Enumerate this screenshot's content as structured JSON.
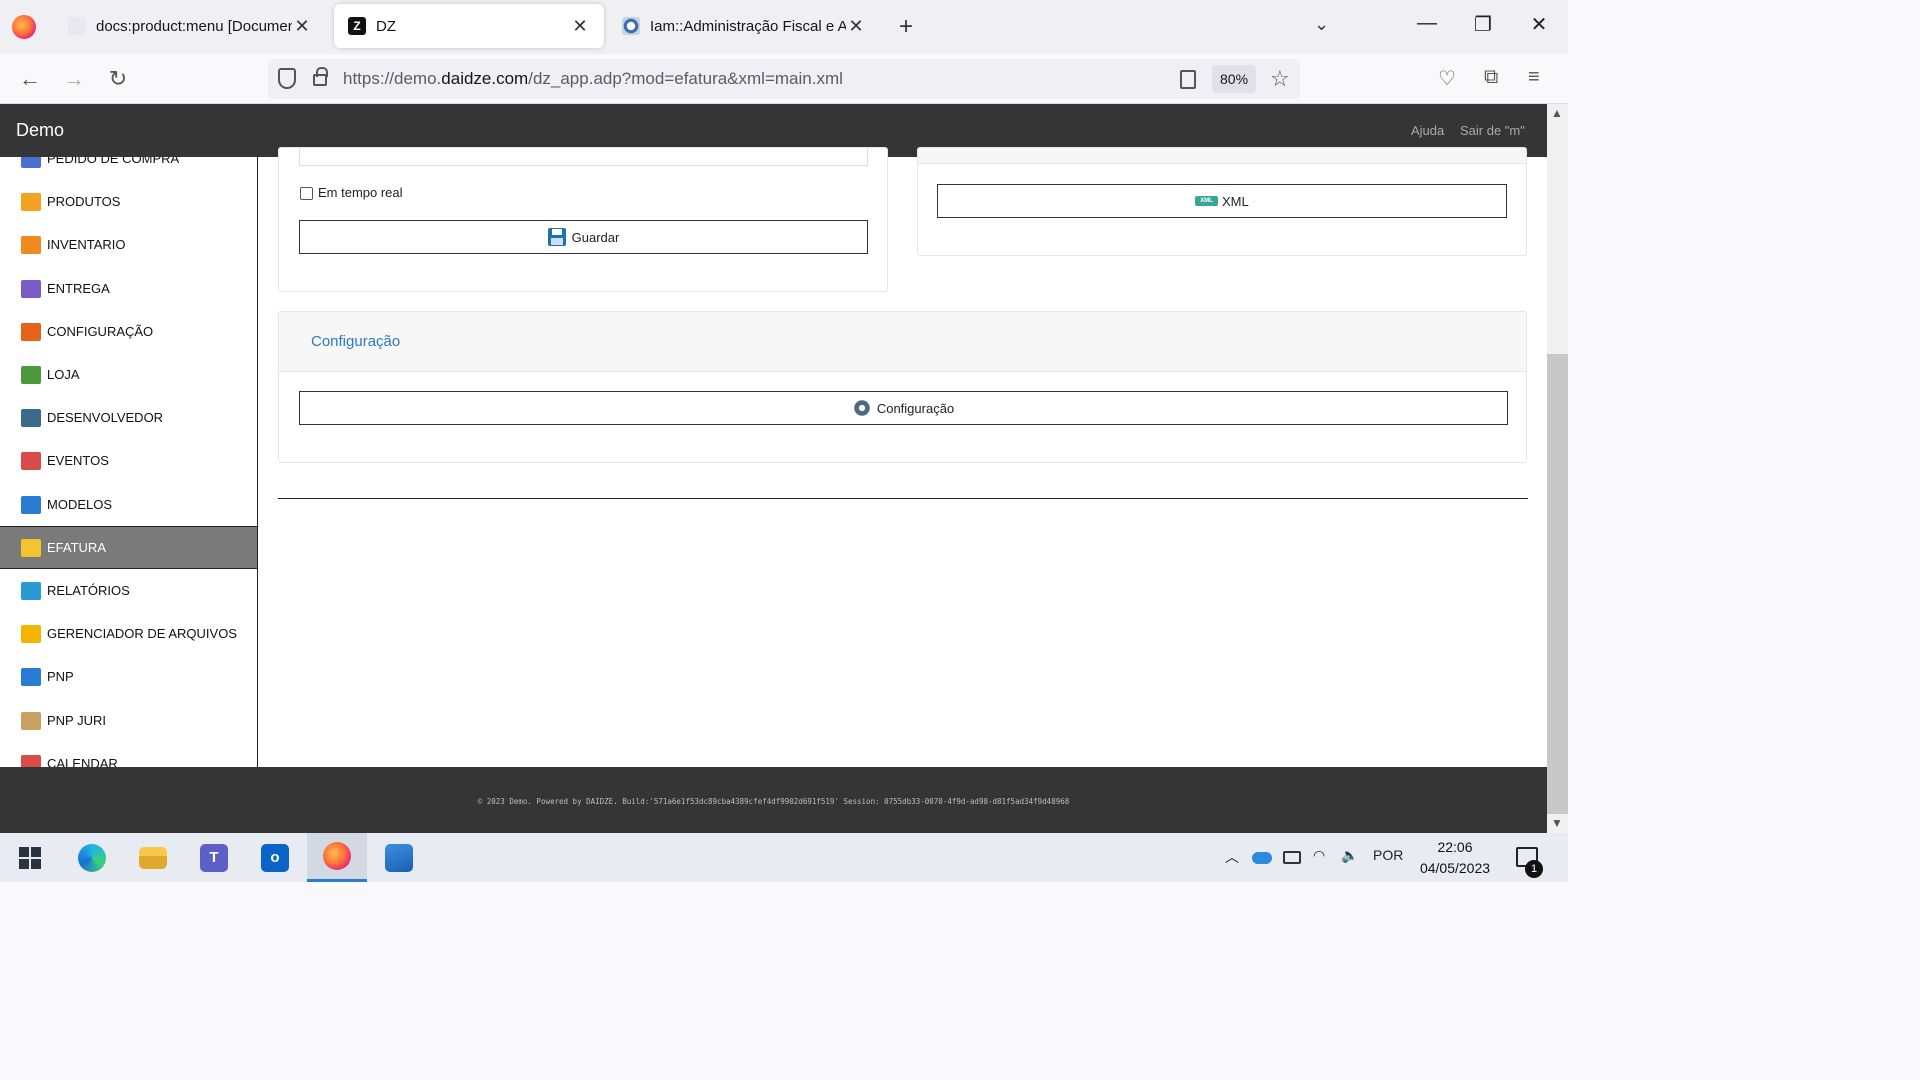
{
  "browser": {
    "tabs": [
      {
        "title": "docs:product:menu [Documentação",
        "close": "✕"
      },
      {
        "title": "DZ",
        "close": "✕"
      },
      {
        "title": "Iam::Administração Fiscal e Adu",
        "close": "✕"
      }
    ],
    "new_tab": "+",
    "url_prefix": "https://demo.",
    "url_domain": "daidze.com",
    "url_path": "/dz_app.adp?mod=efatura&xml=main.xml",
    "zoom": "80%"
  },
  "app": {
    "brand": "Demo",
    "help": "Ajuda",
    "logout": "Sair de \"m\""
  },
  "sidebar": {
    "items": [
      {
        "label": "PEDIDO DE COMPRA",
        "icon": "purchase-order-icon",
        "color": "#4a6fd1"
      },
      {
        "label": "PRODUTOS",
        "icon": "products-icon",
        "color": "#f4a321"
      },
      {
        "label": "INVENTARIO",
        "icon": "inventory-icon",
        "color": "#f08a1c"
      },
      {
        "label": "ENTREGA",
        "icon": "delivery-truck-icon",
        "color": "#7a5cc7"
      },
      {
        "label": "CONFIGURAÇÃO",
        "icon": "config-gears-icon",
        "color": "#e8631a"
      },
      {
        "label": "LOJA",
        "icon": "store-icon",
        "color": "#4a9a3c"
      },
      {
        "label": "DESENVOLVEDOR",
        "icon": "developer-icon",
        "color": "#3c6a8a"
      },
      {
        "label": "EVENTOS",
        "icon": "calendar-events-icon",
        "color": "#d94b4b"
      },
      {
        "label": "MODELOS",
        "icon": "models-icon",
        "color": "#2a7bd4"
      },
      {
        "label": "EFATURA",
        "icon": "efatura-list-icon",
        "color": "#f4c430",
        "active": true
      },
      {
        "label": "RELATÓRIOS",
        "icon": "reports-pie-icon",
        "color": "#2a9ad4"
      },
      {
        "label": "GERENCIADOR DE ARQUIVOS",
        "icon": "folder-icon",
        "color": "#f4b400"
      },
      {
        "label": "PNP",
        "icon": "pnp-people-icon",
        "color": "#2a7bd4"
      },
      {
        "label": "PNP JURI",
        "icon": "pnp-juri-icon",
        "color": "#c8a060"
      },
      {
        "label": "CALENDAR",
        "icon": "calendar-icon",
        "color": "#d94b4b"
      }
    ]
  },
  "main": {
    "realtime_label": "Em tempo real",
    "save_label": "Guardar",
    "xml_label": "XML",
    "xml_badge": "XML",
    "config_panel_title": "Configuração",
    "config_button_label": "Configuração"
  },
  "footer": {
    "text": "© 2023 Demo. Powered by DAIDZE. Build:'571a6e1f53dc89cba4389cfef4df9902d691f519' Session: 0755db33-0070-4f9d-ad98-d81f5ad34f9d48968"
  },
  "taskbar": {
    "language": "POR",
    "time": "22:06",
    "date": "04/05/2023",
    "notifications": "1"
  }
}
